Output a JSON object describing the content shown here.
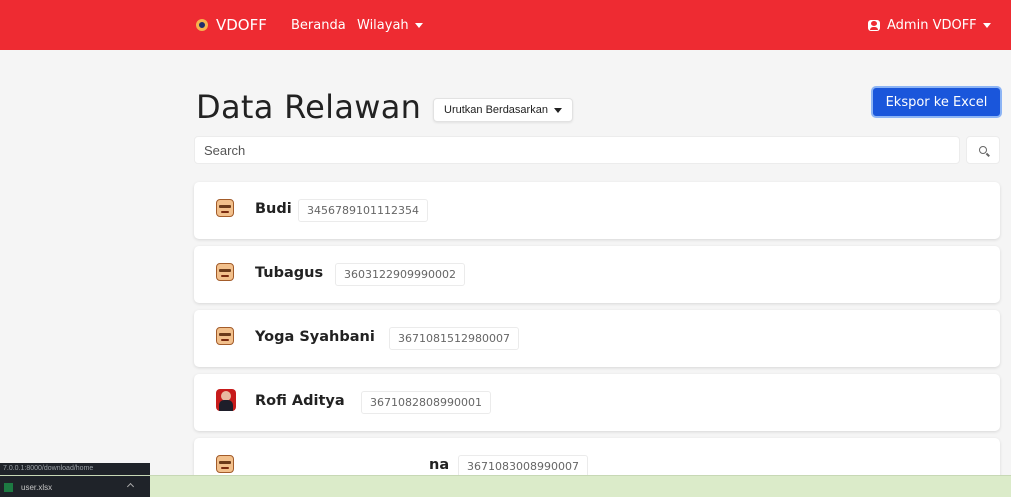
{
  "navbar": {
    "brand": "VDOFF",
    "links": [
      "Beranda",
      "Wilayah"
    ],
    "user": "Admin VDOFF"
  },
  "page": {
    "title": "Data Relawan",
    "sort_label": "Urutkan Berdasarkan",
    "export_label": "Ekspor ke Excel",
    "search_placeholder": "Search"
  },
  "volunteers": [
    {
      "name": "Budi",
      "nik": "3456789101112354",
      "avatar": "cartoon-face-icon"
    },
    {
      "name": "Tubagus",
      "nik": "3603122909990002",
      "avatar": "cartoon-face-icon"
    },
    {
      "name": "Yoga Syahbani",
      "nik": "3671081512980007",
      "avatar": "cartoon-face-icon"
    },
    {
      "name": "Rofi Aditya",
      "nik": "3671082808990001",
      "avatar": "person-photo"
    },
    {
      "name": "na",
      "nik": "3671083008990007",
      "avatar": "cartoon-face-icon"
    }
  ],
  "status_bar": {
    "url": "7.0.0.1:8000/download/home"
  },
  "downloads": {
    "file_name": "user.xlsx"
  },
  "colors": {
    "navbar": "#ee2b32",
    "export_button": "#1a56db"
  }
}
